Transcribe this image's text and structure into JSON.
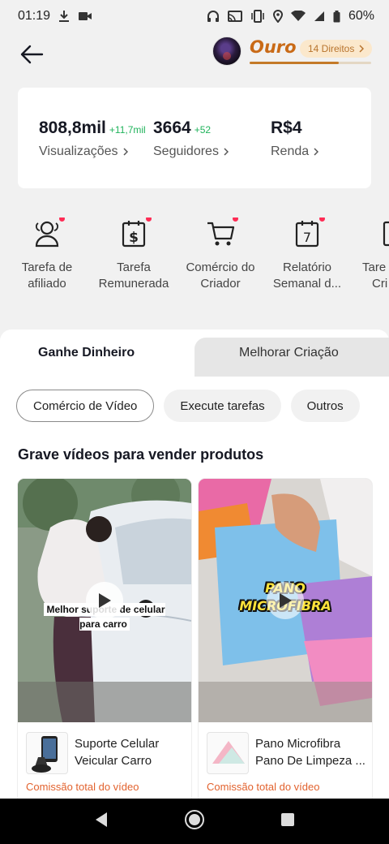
{
  "status_bar": {
    "time": "01:19",
    "battery": "60%",
    "left_icons": [
      "download-icon",
      "video-camera-icon"
    ],
    "right_icons": [
      "headphones-icon",
      "cast-icon",
      "vibrate-icon",
      "location-icon",
      "wifi-icon",
      "signal-icon",
      "battery-icon"
    ]
  },
  "header": {
    "tier": "Ouro",
    "rights": "14 Direitos",
    "tier_progress": 0.73,
    "accent_color": "#c96a17"
  },
  "stats": [
    {
      "value": "808,8mil",
      "delta": "+11,7mil",
      "label": "Visualizações"
    },
    {
      "value": "3664",
      "delta": "+52",
      "label": "Seguidores"
    },
    {
      "value": "R$4",
      "delta": "",
      "label": "Renda"
    }
  ],
  "actions": [
    {
      "line1": "Tarefa de",
      "line2": "afiliado",
      "icon": "affiliate-people-icon",
      "badge": true
    },
    {
      "line1": "Tarefa",
      "line2": "Remunerada",
      "icon": "dollar-calendar-icon",
      "badge": true
    },
    {
      "line1": "Comércio do",
      "line2": "Criador",
      "icon": "shopping-cart-icon",
      "badge": true
    },
    {
      "line1": "Relatório",
      "line2": "Semanal d...",
      "icon": "calendar-7-icon",
      "badge": true
    },
    {
      "line1": "Tare",
      "line2": "Cri",
      "icon": "document-icon",
      "badge": false
    }
  ],
  "tabs": [
    {
      "label": "Ganhe Dinheiro",
      "active": true
    },
    {
      "label": "Melhorar Criação",
      "active": false
    }
  ],
  "chips": [
    {
      "label": "Comércio de Vídeo",
      "active": true
    },
    {
      "label": "Execute tarefas",
      "active": false
    },
    {
      "label": "Outros",
      "active": false
    }
  ],
  "section_title": "Grave vídeos para vender produtos",
  "cards": [
    {
      "overlay_text": "Melhor suporte de celular para carro",
      "product_name": "Suporte Celular Veicular Carro Vent...",
      "commission": "Comissão total do vídeo"
    },
    {
      "overlay_text": "PANO MICROFIBRA",
      "product_name": "Pano Microfibra Pano De Limpeza ...",
      "commission": "Comissão total do vídeo"
    }
  ],
  "nav_bar": [
    "back-triangle-icon",
    "home-circle-icon",
    "recents-square-icon"
  ]
}
